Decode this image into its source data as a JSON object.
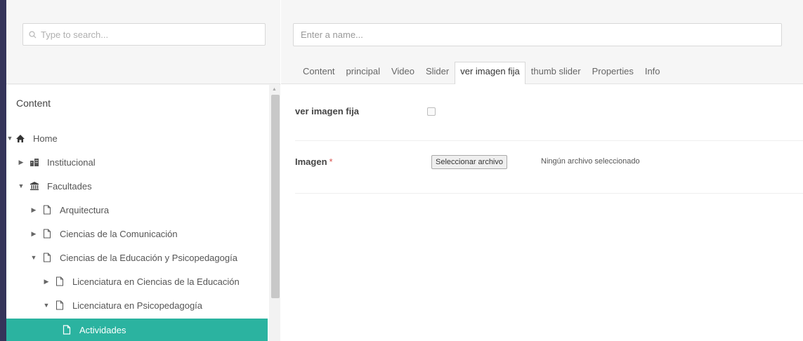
{
  "search": {
    "placeholder": "Type to search..."
  },
  "tree": {
    "title": "Content",
    "items": [
      {
        "label": "Home",
        "caret": "▼",
        "icon": "home-icon"
      },
      {
        "label": "Institucional",
        "caret": "▶",
        "icon": "buildings-icon"
      },
      {
        "label": "Facultades",
        "caret": "▼",
        "icon": "bank-icon"
      },
      {
        "label": "Arquitectura",
        "caret": "▶",
        "icon": "document-icon"
      },
      {
        "label": "Ciencias de la Comunicación",
        "caret": "▶",
        "icon": "document-icon"
      },
      {
        "label": "Ciencias de la Educación y Psicopedagogía",
        "caret": "▼",
        "icon": "document-icon"
      },
      {
        "label": "Licenciatura en Ciencias de la Educación",
        "caret": "▶",
        "icon": "document-icon"
      },
      {
        "label": "Licenciatura en Psicopedagogía",
        "caret": "▼",
        "icon": "document-icon"
      },
      {
        "label": "Actividades",
        "caret": "",
        "icon": "document-icon",
        "selected": true
      }
    ]
  },
  "editor": {
    "name_placeholder": "Enter a name...",
    "tabs": [
      "Content",
      "principal",
      "Video",
      "Slider",
      "ver imagen fija",
      "thumb slider",
      "Properties",
      "Info"
    ],
    "active_tab": "ver imagen fija",
    "fields": {
      "ver_imagen_fija": {
        "label": "ver imagen fija",
        "checked": false
      },
      "imagen": {
        "label": "Imagen",
        "required_mark": "*",
        "button_label": "Seleccionar archivo",
        "status": "Ningún archivo seleccionado"
      }
    }
  },
  "colors": {
    "selected": "#2bb3a0",
    "edge_strip": "#35345a",
    "required": "#d9534f"
  }
}
